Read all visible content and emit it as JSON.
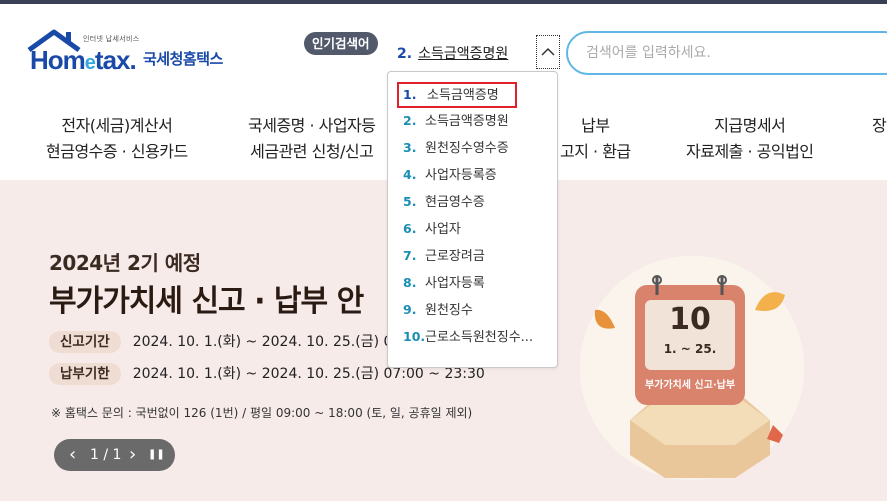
{
  "logo": {
    "small_text": "인터넷 납세서비스",
    "home_text": "Hom",
    "e_text": "e",
    "tax_text": "tax.",
    "korean_name": "국세청홈택스"
  },
  "popular": {
    "badge": "인기검색어",
    "current_num": "2.",
    "current_text": "소득금액증명원",
    "items": [
      {
        "num": "1.",
        "text": "소득금액증명"
      },
      {
        "num": "2.",
        "text": "소득금액증명원"
      },
      {
        "num": "3.",
        "text": "원천징수영수증"
      },
      {
        "num": "4.",
        "text": "사업자등록증"
      },
      {
        "num": "5.",
        "text": "현금영수증"
      },
      {
        "num": "6.",
        "text": "사업자"
      },
      {
        "num": "7.",
        "text": "근로장려금"
      },
      {
        "num": "8.",
        "text": "사업자등록"
      },
      {
        "num": "9.",
        "text": "원천징수"
      },
      {
        "num": "10.",
        "text": "근로소득원천징수..."
      }
    ]
  },
  "search": {
    "placeholder": "검색어를 입력하세요."
  },
  "nav": [
    {
      "line1": "전자(세금)계산서",
      "line2": "현금영수증 · 신용카드"
    },
    {
      "line1": "국세증명 · 사업자등",
      "line2": "세금관련 신청/신고"
    },
    {
      "line1": "납부",
      "line2": "고지 · 환급"
    },
    {
      "line1": "지급명세서",
      "line2": "자료제출 · 공익법인"
    },
    {
      "line1": "장",
      "line2": ""
    }
  ],
  "banner": {
    "subtitle": "2024년 2기 예정",
    "title": "부가가치세 신고 · 납부 안",
    "rows": [
      {
        "label": "신고기간",
        "value": "2024. 10. 1.(화) ~ 2024. 10. 25.(금) 0"
      },
      {
        "label": "납부기한",
        "value": "2024. 10. 1.(화) ~ 2024. 10. 25.(금) 07:00 ~ 23:30"
      }
    ],
    "note": "※ 홈택스 문의 : 국번없이 126 (1번) / 평일 09:00 ~ 18:00 (토, 일, 공휴일 제외)",
    "pager": {
      "prev": "‹",
      "page": "1 / 1",
      "next": "›",
      "pause": "❚❚"
    },
    "calendar": {
      "day": "10",
      "range": "1. ~ 25.",
      "caption": "부가가치세 신고·납부"
    }
  },
  "colors": {
    "brand_blue": "#1a4aa8",
    "accent_sky": "#5fb7e5",
    "highlight_red": "#e0202a",
    "banner_bg": "#f6ebe9"
  }
}
